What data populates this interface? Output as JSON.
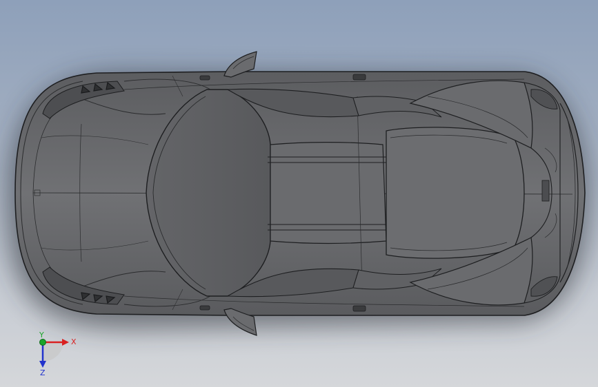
{
  "viewport": {
    "background_top": "#8ea0ba",
    "background_bottom": "#d5d7da",
    "model_color": "#6e6f71"
  },
  "triad": {
    "x_label": "X",
    "y_label": "Y",
    "z_label": "Z",
    "x_color": "#d92020",
    "y_color": "#1aa52a",
    "z_color": "#2233cc"
  }
}
